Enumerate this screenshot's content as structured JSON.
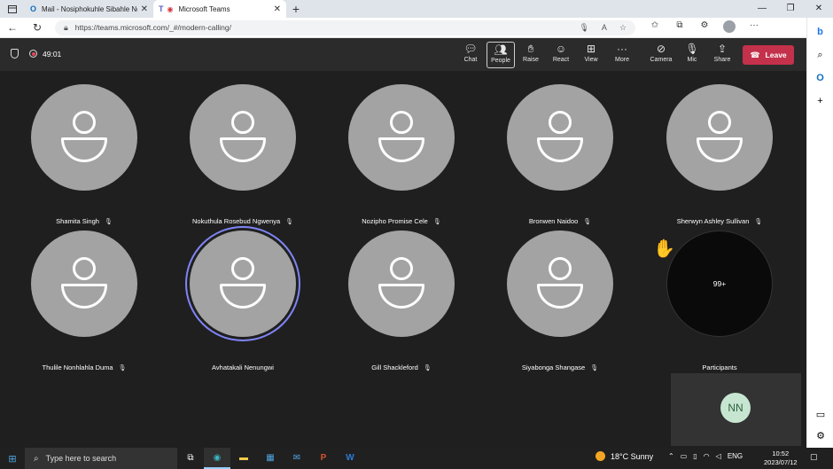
{
  "browser": {
    "tabs": [
      {
        "title": "Mail - Nosiphokuhle Sibahle Ngwenya",
        "icon": "outlook-icon"
      },
      {
        "title": "Microsoft Teams",
        "icon": "teams-icon"
      }
    ],
    "url": "https://teams.microsoft.com/_#/modern-calling/"
  },
  "meeting": {
    "duration": "49:01",
    "toolbar": {
      "chat": "Chat",
      "people": "People",
      "raise": "Raise",
      "react": "React",
      "view": "View",
      "more": "More",
      "camera": "Camera",
      "mic": "Mic",
      "share": "Share",
      "leave": "Leave"
    },
    "participants": [
      {
        "name": "Shamita Singh"
      },
      {
        "name": "Nokuthula Rosebud Ngwenya"
      },
      {
        "name": "Nozipho Promise Cele"
      },
      {
        "name": "Bronwen Naidoo"
      },
      {
        "name": "Sherwyn Ashley Sullivan"
      },
      {
        "name": "Thulile Nonhlahla Duma"
      },
      {
        "name": "Avhatakali Nenungwi"
      },
      {
        "name": "Gill Shackleford"
      },
      {
        "name": "Siyabonga Shangase"
      }
    ],
    "overflow": {
      "count": "99+",
      "label": "Participants"
    },
    "self_initials": "NN"
  },
  "taskbar": {
    "search_placeholder": "Type here to search",
    "weather": "18°C  Sunny",
    "language": "ENG",
    "time": "10:52",
    "date": "2023/07/12"
  },
  "colors": {
    "leave": "#c4314b",
    "speaking_ring": "#7f85f5",
    "accent": "#1a73e8"
  }
}
